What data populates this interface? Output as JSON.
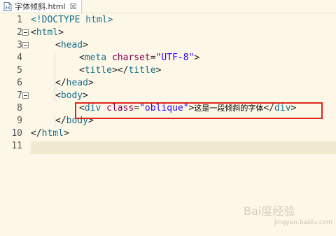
{
  "tab": {
    "filename": "字体倾斜.html",
    "close": "☒"
  },
  "lines": [
    {
      "num": "1"
    },
    {
      "num": "2"
    },
    {
      "num": "3"
    },
    {
      "num": "4"
    },
    {
      "num": "5"
    },
    {
      "num": "6"
    },
    {
      "num": "7"
    },
    {
      "num": "8"
    },
    {
      "num": "9"
    },
    {
      "num": "10"
    },
    {
      "num": "11"
    }
  ],
  "code": {
    "l1": "<!DOCTYPE html>",
    "l2_open": "<",
    "l2_tag": "html",
    "l2_close": ">",
    "l3_open": "<",
    "l3_tag": "head",
    "l3_close": ">",
    "l4_open": "<",
    "l4_tag": "meta",
    "l4_attr": "charset",
    "l4_eq": "=",
    "l4_val": "\"UTF-8\"",
    "l4_close": ">",
    "l5_open": "<",
    "l5_tag": "title",
    "l5_mid": "></",
    "l5_tag2": "title",
    "l5_close": ">",
    "l6_open": "</",
    "l6_tag": "head",
    "l6_close": ">",
    "l7_open": "<",
    "l7_tag": "body",
    "l7_close": ">",
    "l8_open": "<",
    "l8_tag": "div",
    "l8_attr": "class",
    "l8_eq": "=",
    "l8_val": "\"oblique\"",
    "l8_close": ">",
    "l8_text": "这是一段倾斜的字体",
    "l8_end_open": "</",
    "l8_end_tag": "div",
    "l8_end_close": ">",
    "l9_open": "</",
    "l9_tag": "body",
    "l9_close": ">",
    "l10_open": "</",
    "l10_tag": "html",
    "l10_close": ">"
  },
  "watermark": {
    "main": "Bai度经验",
    "sub": "jingyan.baidu.com"
  }
}
